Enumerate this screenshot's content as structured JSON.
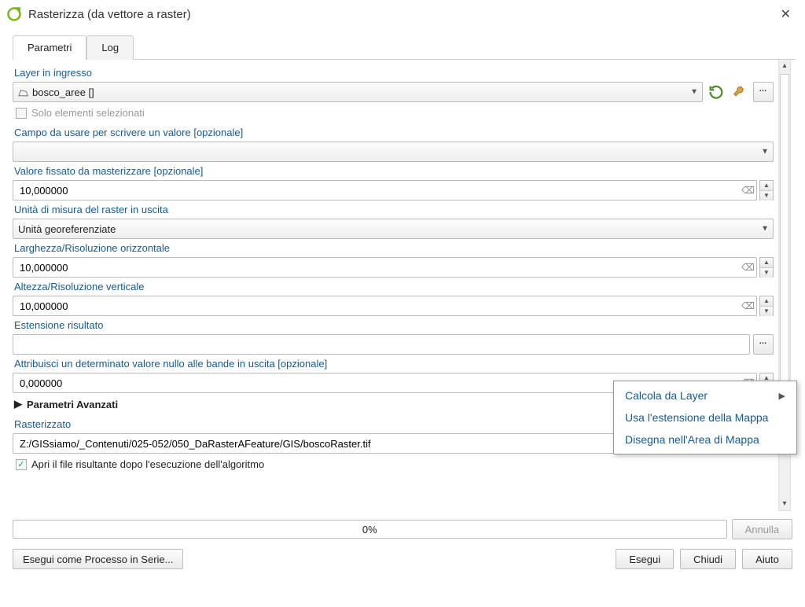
{
  "window": {
    "title": "Rasterizza (da vettore a raster)"
  },
  "tabs": {
    "param": "Parametri",
    "log": "Log"
  },
  "labels": {
    "layer_in": "Layer in ingresso",
    "only_selected": "Solo elementi selezionati",
    "field": "Campo da usare per scrivere un valore [opzionale]",
    "burn": "Valore fissato da masterizzare [opzionale]",
    "units": "Unità di misura del raster in uscita",
    "width": "Larghezza/Risoluzione orizzontale",
    "height": "Altezza/Risoluzione verticale",
    "extent": "Estensione risultato",
    "nodata": "Attribuisci un determinato valore nullo alle bande in uscita [opzionale]",
    "advanced": "Parametri Avanzati",
    "output": "Rasterizzato",
    "open_after": "Apri il file risultante dopo l'esecuzione dell'algoritmo"
  },
  "values": {
    "layer": "bosco_aree []",
    "field": "",
    "burn": "10,000000",
    "units": "Unità georeferenziate",
    "width": "10,000000",
    "height": "10,000000",
    "extent": "",
    "nodata": "0,000000",
    "output": "Z:/GISsiamo/_Contenuti/025-052/050_DaRasterAFeature/GIS/boscoRaster.tif",
    "progress": "0%"
  },
  "buttons": {
    "cancel": "Annulla",
    "batch": "Esegui come Processo in Serie...",
    "run": "Esegui",
    "close": "Chiudi",
    "help": "Aiuto"
  },
  "popup": {
    "calc_layer": "Calcola da Layer",
    "use_map": "Usa l'estensione della Mappa",
    "draw_map": "Disegna nell'Area di Mappa"
  }
}
